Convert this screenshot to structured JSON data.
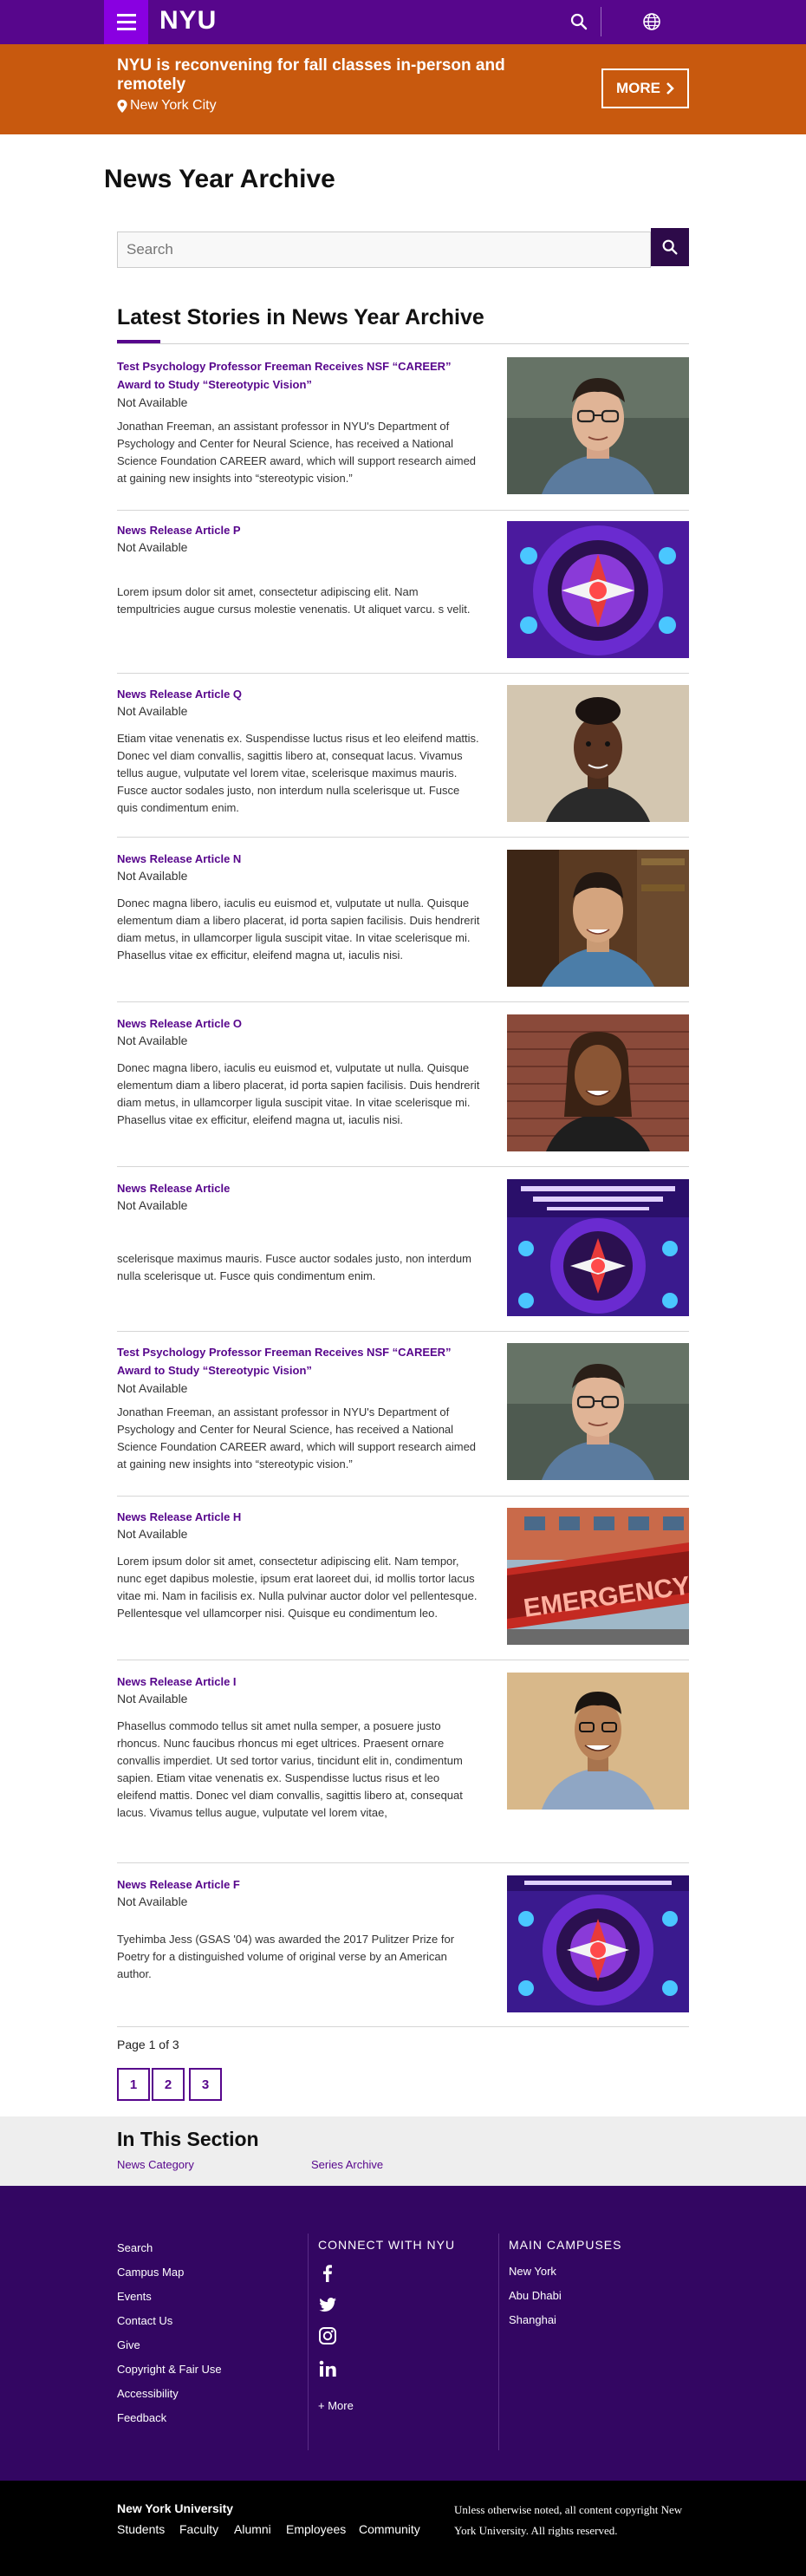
{
  "header": {
    "logo": "NYU",
    "menu_icon": "hamburger-menu-icon",
    "search_icon": "search-icon",
    "globe_icon": "globe-icon"
  },
  "alert": {
    "title": "NYU is reconvening for fall classes in-person and remotely",
    "location": "New York City",
    "location_icon": "map-pin-icon",
    "more_label": "MORE",
    "more_icon": "chevron-right-icon"
  },
  "page_title": "News Year Archive",
  "search": {
    "placeholder": "Search",
    "button_icon": "search-icon"
  },
  "section_title": "Latest Stories in News Year Archive",
  "articles": [
    {
      "title": "Test Psychology Professor Freeman Receives NSF “CAREER” Award to Study “Stereotypic Vision”",
      "date": "Not Available",
      "desc": "Jonathan Freeman, an assistant professor in NYU's Department of Psychology and Center for Neural Science, has received a National Science Foundation CAREER award, which will support research aimed at gaining new insights into “stereotypic vision.”",
      "image": "portrait-man-glasses"
    },
    {
      "title": "News Release Article P",
      "date": "Not Available",
      "desc": "Lorem ipsum dolor sit amet, consectetur adipiscing elit. Nam tempultricies augue cursus molestie venenatis. Ut aliquet varcu. s velit.",
      "image": "psychedelic-graphic"
    },
    {
      "title": "News Release Article Q",
      "date": "Not Available",
      "desc": "Etiam vitae venenatis ex. Suspendisse luctus risus et leo eleifend mattis. Donec vel diam convallis, sagittis libero at, consequat lacus. Vivamus tellus augue, vulputate vel lorem vitae, scelerisque maximus mauris. Fusce auctor sodales justo, non interdum nulla scelerisque ut. Fusce quis condimentum enim.",
      "image": "portrait-woman"
    },
    {
      "title": "News Release Article N",
      "date": "Not Available",
      "desc": "Donec magna libero, iaculis eu euismod et, vulputate ut nulla. Quisque elementum diam a libero placerat, id porta sapien facilisis. Duis hendrerit diam metus, in ullamcorper ligula suscipit vitae. In vitae scelerisque mi. Phasellus vitae ex efficitur, eleifend magna ut, iaculis nisi.",
      "image": "portrait-man-bookshelf"
    },
    {
      "title": "News Release Article O",
      "date": "Not Available",
      "desc": "Donec magna libero, iaculis eu euismod et, vulputate ut nulla. Quisque elementum diam a libero placerat, id porta sapien facilisis. Duis hendrerit diam metus, in ullamcorper ligula suscipit vitae. In vitae scelerisque mi. Phasellus vitae ex efficitur, eleifend magna ut, iaculis nisi.",
      "image": "portrait-woman-brick"
    },
    {
      "title": "News Release Article",
      "date": "Not Available",
      "desc": "scelerisque maximus mauris. Fusce auctor sodales justo, non interdum nulla scelerisque ut. Fusce quis condimentum enim.",
      "image": "psychedelic-poster"
    },
    {
      "title": "Test Psychology Professor Freeman Receives NSF “CAREER” Award to Study “Stereotypic Vision”",
      "date": "Not Available",
      "desc": "Jonathan Freeman, an assistant professor in NYU's Department of Psychology and Center for Neural Science, has received a National Science Foundation CAREER award, which will support research aimed at gaining new insights into “stereotypic vision.”",
      "image": "portrait-man-glasses"
    },
    {
      "title": "News Release Article H",
      "date": "Not Available",
      "desc": "Lorem ipsum dolor sit amet, consectetur adipiscing elit. Nam tempor, nunc eget dapibus molestie, ipsum erat laoreet dui, id mollis tortor lacus vitae mi. Nam in facilisis ex. Nulla pulvinar auctor dolor vel pellentesque. Pellentesque vel ullamcorper nisi. Quisque eu condimentum leo.",
      "image": "emergency-sign"
    },
    {
      "title": "News Release Article I",
      "date": "Not Available",
      "desc": "Phasellus commodo tellus sit amet nulla semper, a posuere justo rhoncus. Nunc faucibus rhoncus mi eget ultrices. Praesent ornare convallis imperdiet. Ut sed tortor varius, tincidunt elit in, condimentum sapien. Etiam vitae venenatis ex. Suspendisse luctus risus et leo eleifend mattis. Donec vel diam convallis, sagittis libero at, consequat lacus. Vivamus tellus augue, vulputate vel lorem vitae,",
      "image": "portrait-man-smiling"
    },
    {
      "title": "News Release Article F",
      "date": "Not Available",
      "desc": "Tyehimba Jess (GSAS '04) was awarded the 2017 Pulitzer Prize for Poetry for a distinguished volume of original verse by an American author.",
      "image": "psychedelic-poster"
    }
  ],
  "pagination": {
    "prefix": "Page ",
    "current": "1",
    "of_label": " of ",
    "total": "3",
    "pages": [
      "1",
      "2",
      "3"
    ]
  },
  "in_section": {
    "title": "In This Section",
    "links": [
      "News Category",
      "Series Archive"
    ]
  },
  "footer": {
    "links": [
      "Search",
      "Campus Map",
      "Events",
      "Contact Us",
      "Give",
      "Copyright & Fair Use",
      "Accessibility",
      "Feedback"
    ],
    "connect_heading": "CONNECT WITH NYU",
    "social_icons": [
      "facebook-icon",
      "twitter-icon",
      "instagram-icon",
      "linkedin-icon"
    ],
    "more_label": "+ More",
    "campuses_heading": "MAIN CAMPUSES",
    "campuses": [
      "New York",
      "Abu Dhabi",
      "Shanghai"
    ]
  },
  "bottom": {
    "org": "New York University",
    "links": [
      "Students",
      "Faculty",
      "Alumni",
      "Employees",
      "Community"
    ],
    "copyright": "Unless otherwise noted, all content copyright New York University. All rights reserved."
  },
  "colors": {
    "brand": "#57068c",
    "alert": "#c8590e",
    "footer": "#330662",
    "hamburger": "#8900e1"
  }
}
